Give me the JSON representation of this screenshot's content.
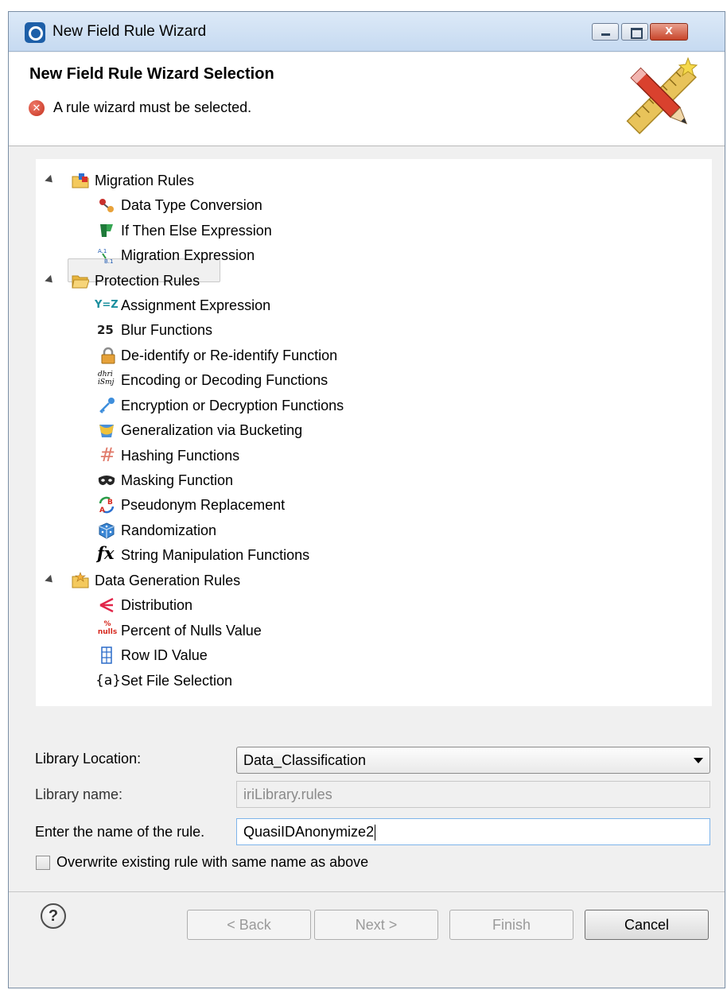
{
  "window": {
    "title": "New Field Rule Wizard",
    "controls": {
      "minimize": "minimize",
      "maximize": "maximize",
      "close": "x"
    }
  },
  "header": {
    "title": "New Field Rule Wizard Selection",
    "message": "A rule wizard must be selected.",
    "banner_icon": "pencil-ruler-icon"
  },
  "tree": {
    "groups": [
      {
        "label": "Migration Rules",
        "icon": "folder-icon",
        "items": [
          {
            "label": "Data Type Conversion",
            "icon": "data-type-icon"
          },
          {
            "label": "If Then Else Expression",
            "icon": "branch-icon"
          },
          {
            "label": "Migration Expression",
            "icon": "migration-icon"
          }
        ]
      },
      {
        "label": "Protection Rules",
        "icon": "folder-open-icon",
        "selected": true,
        "items": [
          {
            "label": "Assignment Expression",
            "icon": "assignment-icon",
            "glyph": "Y=Z"
          },
          {
            "label": "Blur Functions",
            "icon": "blur-icon",
            "glyph": "25"
          },
          {
            "label": "De-identify or Re-identify Function",
            "icon": "lock-icon"
          },
          {
            "label": "Encoding or Decoding Functions",
            "icon": "encoding-icon",
            "glyph": "dhri iSmj"
          },
          {
            "label": "Encryption or Decryption Functions",
            "icon": "key-icon"
          },
          {
            "label": "Generalization via Bucketing",
            "icon": "bucket-icon"
          },
          {
            "label": "Hashing Functions",
            "icon": "hash-icon",
            "glyph": "#"
          },
          {
            "label": "Masking Function",
            "icon": "mask-icon"
          },
          {
            "label": "Pseudonym Replacement",
            "icon": "swap-icon",
            "glyph": "AB"
          },
          {
            "label": "Randomization",
            "icon": "dice-icon"
          },
          {
            "label": "String Manipulation Functions",
            "icon": "function-icon",
            "glyph": "fx"
          }
        ]
      },
      {
        "label": "Data Generation Rules",
        "icon": "folder-star-icon",
        "items": [
          {
            "label": "Distribution",
            "icon": "distribution-icon"
          },
          {
            "label": "Percent of Nulls Value",
            "icon": "nulls-icon",
            "glyph": "% nulls"
          },
          {
            "label": "Row ID Value",
            "icon": "row-id-icon"
          },
          {
            "label": "Set File Selection",
            "icon": "set-icon",
            "glyph": "{a}"
          }
        ]
      }
    ]
  },
  "form": {
    "library_location_label": "Library Location:",
    "library_location_value": "Data_Classification",
    "library_name_label": "Library name:",
    "library_name_value": "iriLibrary.rules",
    "rule_name_label": "Enter the name of the rule.",
    "rule_name_value": "QuasiIDAnonymize2",
    "overwrite_label": "Overwrite existing rule with same name as above",
    "overwrite_checked": false
  },
  "footer": {
    "help": "?",
    "back_label": "< Back",
    "next_label": "Next >",
    "finish_label": "Finish",
    "cancel_label": "Cancel"
  }
}
